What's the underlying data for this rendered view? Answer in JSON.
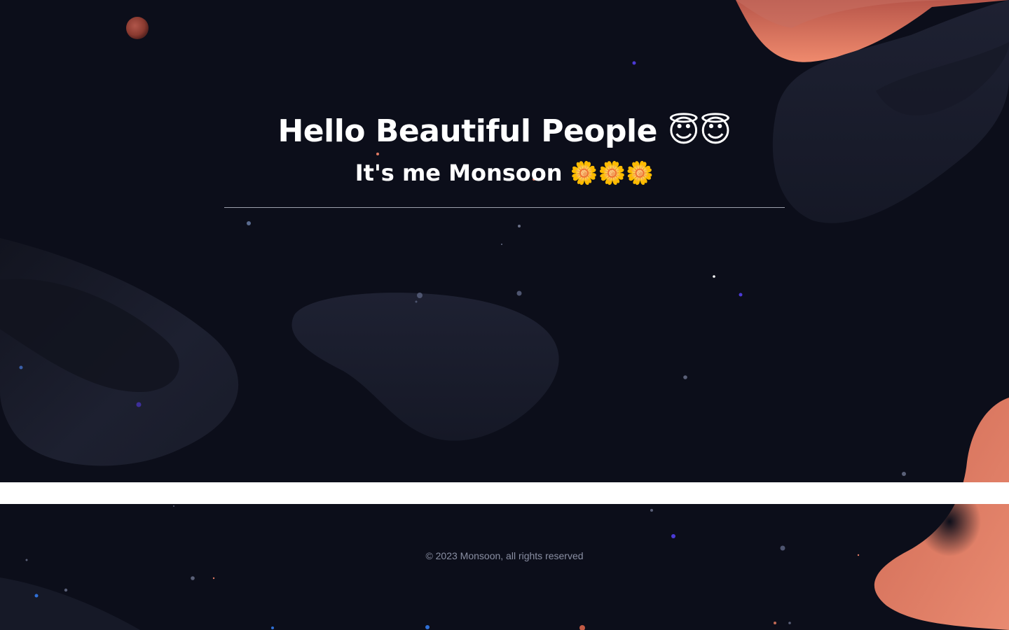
{
  "hero": {
    "title": "Hello Beautiful People 😇😇",
    "subtitle": "It's me Monsoon 🌼🌼🌼"
  },
  "footer": {
    "copyright": "© 2023 Monsoon, all rights reserved"
  },
  "colors": {
    "background": "#0c0e1a",
    "blob_dark": "#1c1f2e",
    "accent_coral": "#e07a63",
    "band": "#ffffff",
    "footer_text": "#8a8fa3"
  },
  "icons": [
    "smiling-face-with-halo-icon",
    "blossom-icon",
    "planet-icon"
  ]
}
